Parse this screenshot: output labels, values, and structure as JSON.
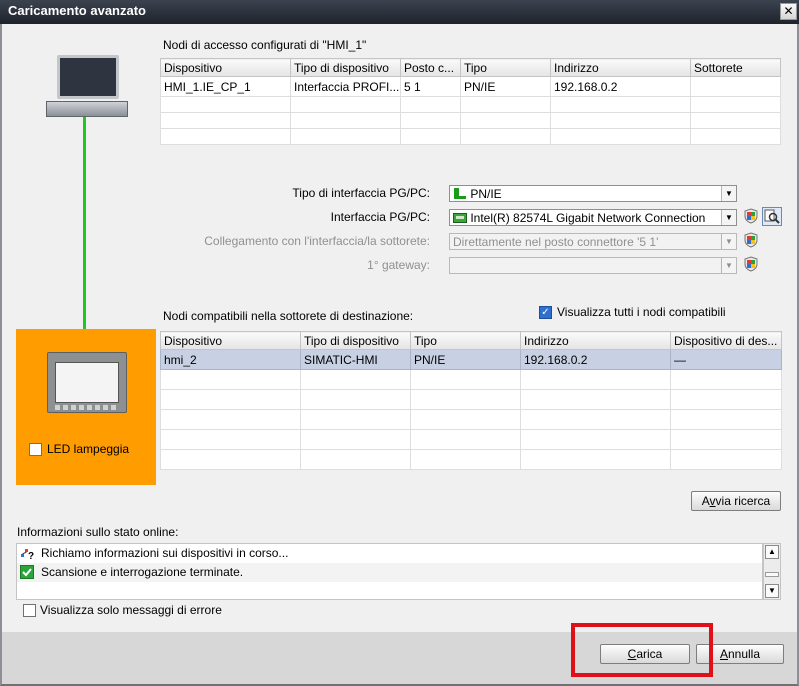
{
  "window": {
    "title": "Caricamento avanzato",
    "close_glyph": "✕"
  },
  "access_nodes": {
    "caption": "Nodi di accesso configurati di \"HMI_1\"",
    "columns": [
      "Dispositivo",
      "Tipo di dispositivo",
      "Posto c...",
      "Tipo",
      "Indirizzo",
      "Sottorete"
    ],
    "rows": [
      [
        "HMI_1.IE_CP_1",
        "Interfaccia PROFI...",
        "5 1",
        "PN/IE",
        "192.168.0.2",
        ""
      ],
      [
        "",
        "",
        "",
        "",
        "",
        ""
      ],
      [
        "",
        "",
        "",
        "",
        "",
        ""
      ],
      [
        "",
        "",
        "",
        "",
        "",
        ""
      ]
    ]
  },
  "interface": {
    "type_label": "Tipo di interfaccia PG/PC:",
    "type_value": "PN/IE",
    "pgpc_label": "Interfaccia PG/PC:",
    "pgpc_value": "Intel(R) 82574L Gigabit Network Connection",
    "conn_label": "Collegamento con l'interfaccia/la sottorete:",
    "conn_value": "Direttamente nel posto connettore '5 1'",
    "gateway_label": "1° gateway:",
    "gateway_value": ""
  },
  "target_nodes": {
    "caption": "Nodi compatibili nella sottorete di destinazione:",
    "show_all_label": "Visualizza tutti i nodi compatibili",
    "show_all_checked": true,
    "columns": [
      "Dispositivo",
      "Tipo di dispositivo",
      "Tipo",
      "Indirizzo",
      "Dispositivo di des..."
    ],
    "rows": [
      [
        "hmi_2",
        "SIMATIC-HMI",
        "PN/IE",
        "192.168.0.2",
        "—"
      ],
      [
        "",
        "",
        "",
        "",
        ""
      ],
      [
        "",
        "",
        "",
        "",
        ""
      ],
      [
        "",
        "",
        "",
        "",
        ""
      ],
      [
        "",
        "",
        "",
        "",
        ""
      ],
      [
        "",
        "",
        "",
        "",
        ""
      ]
    ]
  },
  "led_blink": {
    "label": "LED lampeggia",
    "checked": false
  },
  "search_button": {
    "pre": "A",
    "underlined": "v",
    "post": "via ricerca"
  },
  "status": {
    "caption": "Informazioni sullo stato online:",
    "messages": [
      {
        "icon": "network-search-icon",
        "text": "Richiamo informazioni sui dispositivi in corso..."
      },
      {
        "icon": "check-icon",
        "text": "Scansione e interrogazione terminate."
      }
    ]
  },
  "errors_only": {
    "label": "Visualizza solo messaggi di errore",
    "checked": false
  },
  "footer": {
    "load": {
      "pre": "",
      "underlined": "C",
      "post": "arica"
    },
    "cancel": {
      "pre": "",
      "underlined": "A",
      "post": "nnulla"
    }
  },
  "colors": {
    "link_green": "#1ec81e",
    "device_highlight": "#ff9c00",
    "callout": "#e0101a",
    "check_blue": "#2f6fce"
  }
}
